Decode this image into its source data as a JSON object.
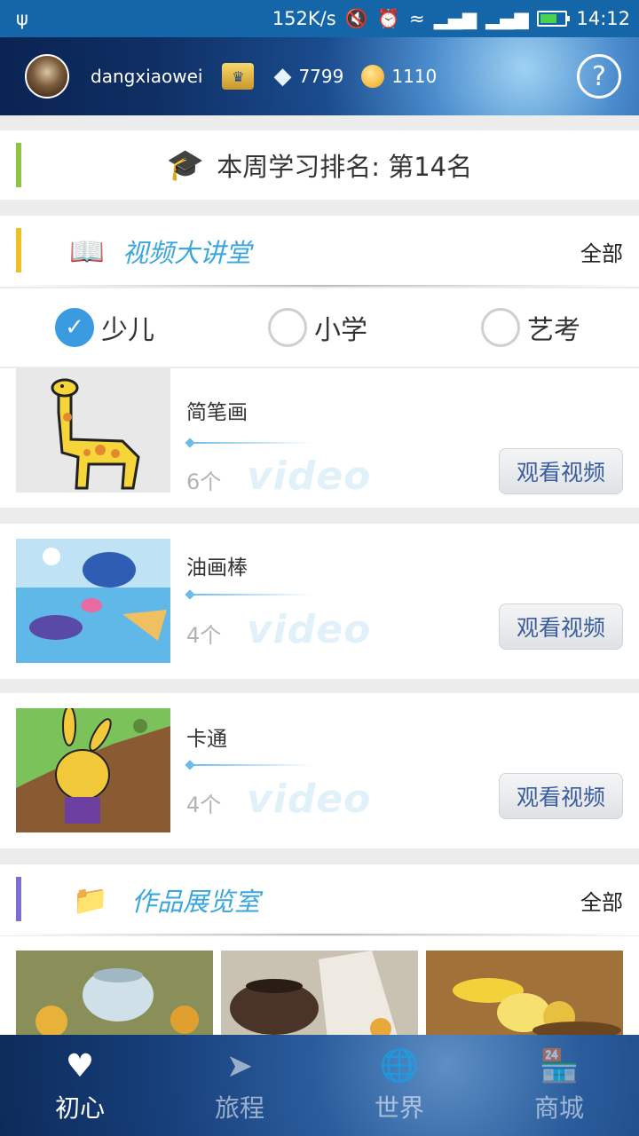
{
  "status_bar": {
    "usb_icon": "usb-icon",
    "net_speed": "152K/s",
    "time": "14:12"
  },
  "header": {
    "username": "dangxiaowei",
    "diamonds": "7799",
    "coins": "1110",
    "help_icon_text": "?"
  },
  "rank": {
    "text": "本周学习排名: 第14名",
    "accent": "#8cc63e"
  },
  "video_section": {
    "title": "视频大讲堂",
    "all_label": "全部",
    "accent": "#f0c020",
    "tabs": [
      {
        "label": "少儿",
        "selected": true
      },
      {
        "label": "小学",
        "selected": false
      },
      {
        "label": "艺考",
        "selected": false
      }
    ],
    "items": [
      {
        "title": "简笔画",
        "count": "6个",
        "watermark": "video",
        "button": "观看视频"
      },
      {
        "title": "油画棒",
        "count": "4个",
        "watermark": "video",
        "button": "观看视频"
      },
      {
        "title": "卡通",
        "count": "4个",
        "watermark": "video",
        "button": "观看视频"
      }
    ]
  },
  "gallery_section": {
    "title": "作品展览室",
    "all_label": "全部",
    "accent": "#7b6fd6"
  },
  "bottom_nav": [
    {
      "label": "初心",
      "icon": "heart-pulse-icon",
      "active": true
    },
    {
      "label": "旅程",
      "icon": "route-icon",
      "active": false
    },
    {
      "label": "世界",
      "icon": "globe-icon",
      "active": false
    },
    {
      "label": "商城",
      "icon": "store-icon",
      "active": false
    }
  ]
}
